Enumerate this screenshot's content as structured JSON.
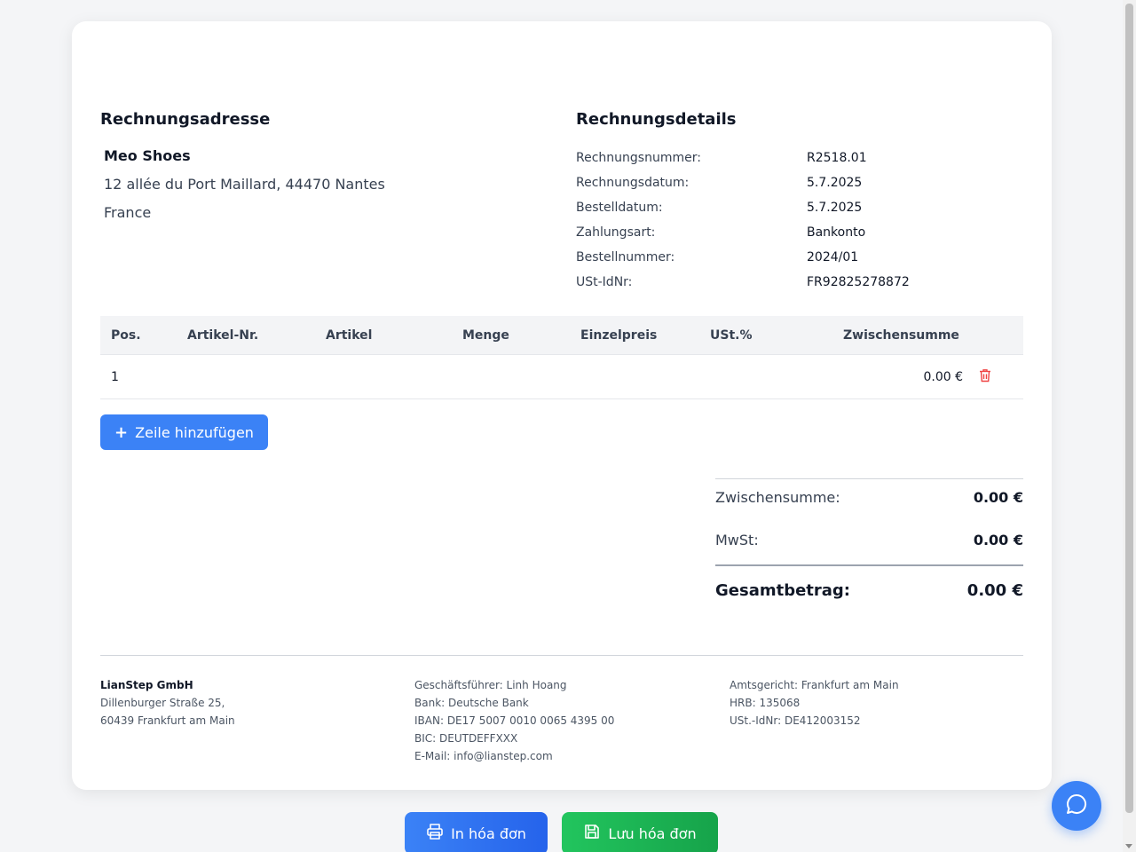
{
  "billing_address": {
    "title": "Rechnungsadresse",
    "name": "Meo Shoes",
    "street": "12 allée du Port Maillard, 44470 Nantes",
    "country": "France"
  },
  "details": {
    "title": "Rechnungsdetails",
    "rows": [
      {
        "label": "Rechnungsnummer:",
        "value": "R2518.01"
      },
      {
        "label": "Rechnungsdatum:",
        "value": "5.7.2025"
      },
      {
        "label": "Bestelldatum:",
        "value": "5.7.2025"
      },
      {
        "label": "Zahlungsart:",
        "value": "Bankonto"
      },
      {
        "label": "Bestellnummer:",
        "value": "2024/01"
      },
      {
        "label": "USt-IdNr:",
        "value": "FR92825278872"
      }
    ]
  },
  "table": {
    "headers": [
      "Pos.",
      "Artikel-Nr.",
      "Artikel",
      "Menge",
      "Einzelpreis",
      "USt.%",
      "Zwischensumme"
    ],
    "rows": [
      {
        "pos": "1",
        "article_no": "",
        "article": "",
        "qty": "",
        "unit_price": "",
        "vat": "",
        "subtotal": "0.00 €"
      }
    ]
  },
  "add_row_label": "Zeile hinzufügen",
  "totals": {
    "subtotal_label": "Zwischensumme:",
    "subtotal_value": "0.00 €",
    "vat_label": "MwSt:",
    "vat_value": "0.00 €",
    "grand_label": "Gesamtbetrag:",
    "grand_value": "0.00 €"
  },
  "footer": {
    "col1": [
      "LianStep GmbH",
      "Dillenburger Straße 25,",
      "60439 Frankfurt am Main"
    ],
    "col2": [
      "Geschäftsführer: Linh Hoang",
      "Bank: Deutsche Bank",
      "IBAN: DE17 5007 0010 0065 4395 00",
      "BIC: DEUTDEFFXXX",
      "E-Mail: info@lianstep.com"
    ],
    "col3": [
      "Amtsgericht: Frankfurt am Main",
      "HRB: 135068",
      "USt.-IdNr: DE412003152"
    ]
  },
  "buttons": {
    "print": "In hóa đơn",
    "save": "Lưu hóa đơn"
  },
  "colors": {
    "primary": "#3b82f6",
    "success": "#22c55e",
    "danger": "#ef4444"
  }
}
